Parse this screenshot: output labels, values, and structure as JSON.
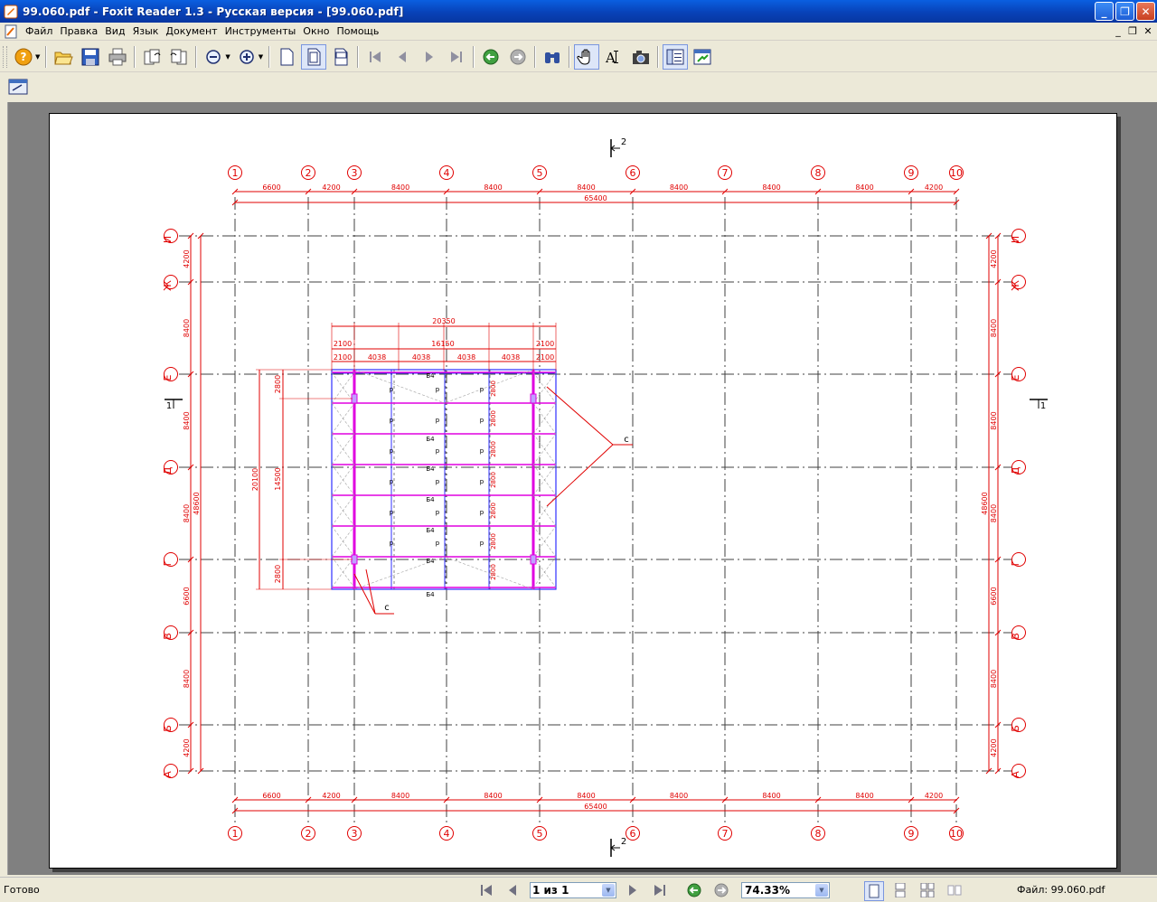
{
  "window": {
    "title": "99.060.pdf - Foxit Reader 1.3 - Русская версия  - [99.060.pdf]",
    "minimize": "_",
    "maximize": "❐",
    "close": "✕"
  },
  "menu": {
    "items": [
      "Файл",
      "Правка",
      "Вид",
      "Язык",
      "Документ",
      "Инструменты",
      "Окно",
      "Помощь"
    ]
  },
  "status": {
    "ready": "Готово",
    "page_field": "1 из 1",
    "zoom_field": "74.33%",
    "filename": "Файл: 99.060.pdf"
  },
  "drawing": {
    "axes_top": [
      "1",
      "2",
      "3",
      "4",
      "5",
      "6",
      "7",
      "8",
      "9",
      "10"
    ],
    "axes_left": [
      "И",
      "Ж",
      "Е",
      "Д",
      "Г",
      "В",
      "Б",
      "А"
    ],
    "dims_top": [
      "6600",
      "4200",
      "8400",
      "8400",
      "8400",
      "8400",
      "8400",
      "8400",
      "4200"
    ],
    "dim_total_top": "65400",
    "dims_left": [
      "4200",
      "8400",
      "8400",
      "8400",
      "6600",
      "8400",
      "4200"
    ],
    "dim_total_left": "48600",
    "section_top": "2",
    "section_left": "1",
    "frame": {
      "dim_overall": "20350",
      "dim_middle": "16150",
      "dim_edge": "2100",
      "dims_bays": [
        "4038",
        "4038",
        "4038",
        "4038"
      ],
      "dim_height_total": "20100",
      "dim_height_inner": "14500",
      "dim_cell": "2800",
      "label_c": "с",
      "label_b4": "Б4",
      "label_p": "р"
    }
  },
  "colors": {
    "title_bar": "#0842b8",
    "drawing_red": "#e00000",
    "drawing_magenta": "#e000e0",
    "drawing_blue": "#3030ff"
  }
}
